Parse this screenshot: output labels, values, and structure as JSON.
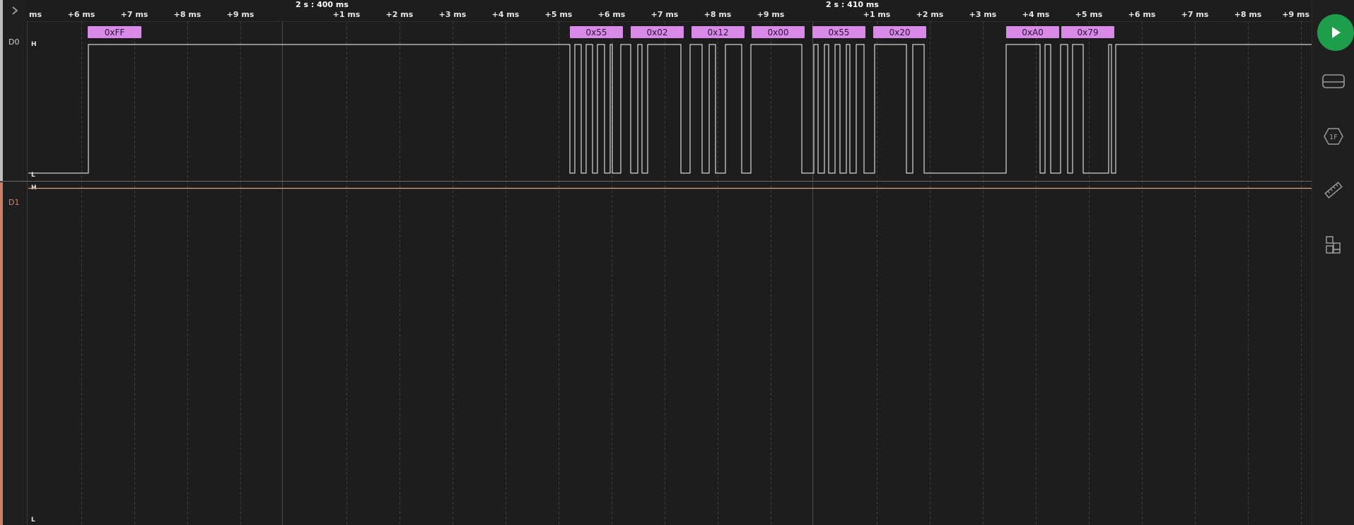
{
  "timeline": {
    "minor_ticks": [
      {
        "label": "ms"
      },
      {
        "label": "+6 ms"
      },
      {
        "label": "+7 ms"
      },
      {
        "label": "+8 ms"
      },
      {
        "label": "+9 ms"
      },
      {
        "label": "+1 ms"
      },
      {
        "label": "+2 ms"
      },
      {
        "label": "+3 ms"
      },
      {
        "label": "+4 ms"
      },
      {
        "label": "+5 ms"
      },
      {
        "label": "+6 ms"
      },
      {
        "label": "+7 ms"
      },
      {
        "label": "+8 ms"
      },
      {
        "label": "+9 ms"
      },
      {
        "label": "+1 ms"
      },
      {
        "label": "+2 ms"
      },
      {
        "label": "+3 ms"
      },
      {
        "label": "+4 ms"
      },
      {
        "label": "+5 ms"
      },
      {
        "label": "+6 ms"
      },
      {
        "label": "+7 ms"
      },
      {
        "label": "+8 ms"
      },
      {
        "label": "+9 ms"
      }
    ],
    "major_ticks": [
      {
        "label": "2 s : 400 ms"
      },
      {
        "label": "2 s : 410 ms"
      }
    ]
  },
  "channels": [
    {
      "name": "D0",
      "high_label": "H",
      "low_label": "L",
      "color": "#cfcfcf"
    },
    {
      "name": "D1",
      "high_label": "H",
      "low_label": "L",
      "color": "#d9856a"
    }
  ],
  "decoder_frames": [
    {
      "value": "0xFF"
    },
    {
      "value": "0x55"
    },
    {
      "value": "0x02"
    },
    {
      "value": "0x12"
    },
    {
      "value": "0x00"
    },
    {
      "value": "0x55"
    },
    {
      "value": "0x20"
    },
    {
      "value": "0xA0"
    },
    {
      "value": "0x79"
    }
  ],
  "colors": {
    "decoder_bg": "#d98ae8",
    "signal_d0": "#ffffff",
    "signal_d1": "#e0a184",
    "play_button": "#1e9e4a"
  },
  "toolbar": {
    "buttons": [
      {
        "name": "play-button",
        "icon": "play-icon"
      },
      {
        "name": "devices-button",
        "icon": "device-icon"
      },
      {
        "name": "analyzers-button",
        "icon": "hex-1f-icon",
        "label": "1F"
      },
      {
        "name": "measure-button",
        "icon": "ruler-icon"
      },
      {
        "name": "extensions-button",
        "icon": "extensions-icon"
      }
    ]
  }
}
